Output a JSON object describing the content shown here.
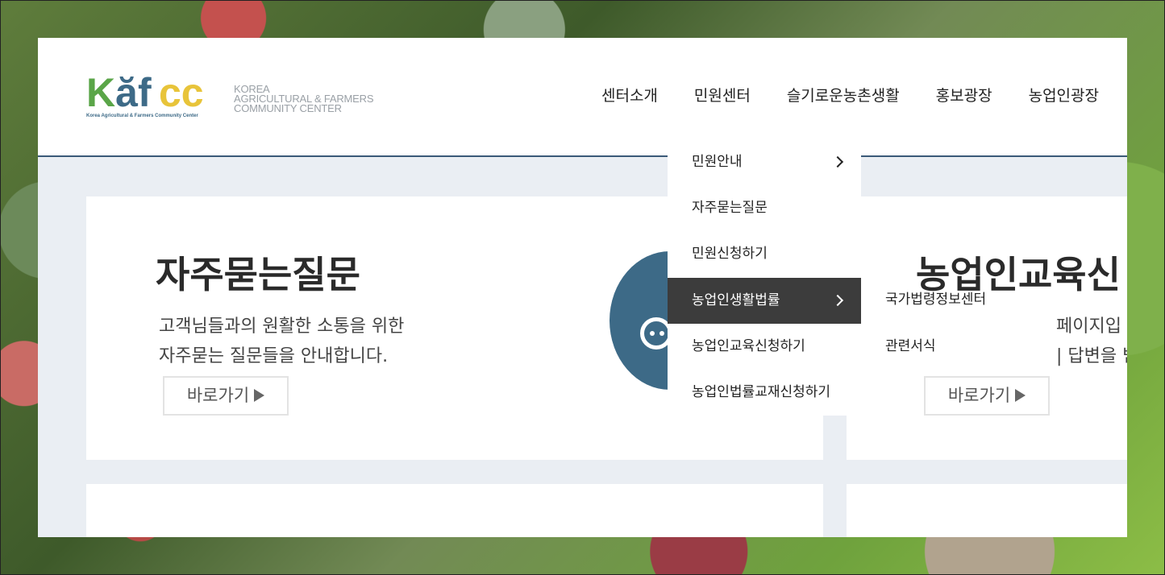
{
  "logo": {
    "letters": [
      "K",
      "ă",
      "f",
      "cc"
    ],
    "tagline": "Korea Agricultural & Farmers Community Center",
    "text_lines": [
      "KOREA",
      "AGRICULTURAL & FARMERS",
      "COMMUNITY CENTER"
    ]
  },
  "nav": {
    "items": [
      "센터소개",
      "민원센터",
      "슬기로운농촌생활",
      "홍보광장",
      "농업인광장"
    ]
  },
  "card1": {
    "title": "자주묻는질문",
    "desc_line1": "고객님들과의 원활한 소통을 위한",
    "desc_line2": "자주묻는 질문들을 안내합니다.",
    "button": "바로가기"
  },
  "card2": {
    "title": "농업인교육신",
    "desc_line1": "페이지입",
    "desc_line2": "| 답변을 빋",
    "button": "바로가기"
  },
  "dropdown": {
    "items": [
      {
        "label": "민원안내",
        "has_sub": true
      },
      {
        "label": "자주묻는질문",
        "has_sub": false
      },
      {
        "label": "민원신청하기",
        "has_sub": false
      },
      {
        "label": "농업인생활법률",
        "has_sub": true
      },
      {
        "label": "농업인교육신청하기",
        "has_sub": false
      },
      {
        "label": "농업인법률교재신청하기",
        "has_sub": false
      }
    ],
    "active_index": 3
  },
  "submenu": {
    "items": [
      "국가법령정보센터",
      "관련서식"
    ]
  },
  "colors": {
    "brand_green": "#5aa548",
    "brand_blue": "#3d6a87",
    "brand_yellow": "#e8c43a",
    "active_menu_bg": "#3c3c3c"
  }
}
